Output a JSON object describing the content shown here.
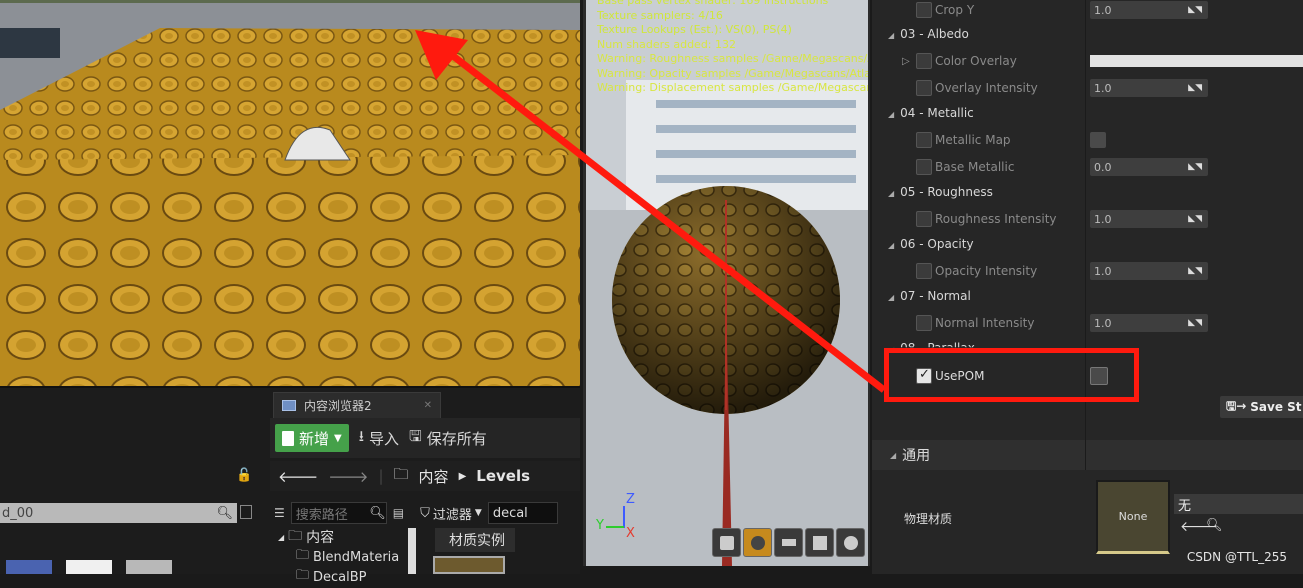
{
  "stats": {
    "lines": [
      "Base pass vertex shader: 169 instructions",
      "Texture samplers: 4/16",
      "Texture Lookups (Est.): VS(0), PS(4)",
      "Num shaders added: 132",
      "Warning: Roughness samples /Game/Megascans/Atl",
      "Warning: Opacity samples /Game/Megascans/Atlas",
      "Warning: Displacement samples /Game/Megascans"
    ]
  },
  "details": {
    "rows": [
      {
        "type": "param",
        "label": "Crop Y",
        "value": "1.0",
        "checked": false
      },
      {
        "type": "group",
        "label": "03 - Albedo"
      },
      {
        "type": "param",
        "label": "Color Overlay",
        "value": "",
        "checked": false,
        "expand": true
      },
      {
        "type": "param",
        "label": "Overlay Intensity",
        "value": "1.0",
        "checked": false
      },
      {
        "type": "group",
        "label": "04 - Metallic"
      },
      {
        "type": "param",
        "label": "Metallic Map",
        "value": "",
        "checked": false,
        "box": true
      },
      {
        "type": "param",
        "label": "Base Metallic",
        "value": "0.0",
        "checked": false
      },
      {
        "type": "group",
        "label": "05 - Roughness"
      },
      {
        "type": "param",
        "label": "Roughness Intensity",
        "value": "1.0",
        "checked": false
      },
      {
        "type": "group",
        "label": "06 - Opacity"
      },
      {
        "type": "param",
        "label": "Opacity Intensity",
        "value": "1.0",
        "checked": false
      },
      {
        "type": "group",
        "label": "07 - Normal"
      },
      {
        "type": "param",
        "label": "Normal Intensity",
        "value": "1.0",
        "checked": false
      },
      {
        "type": "group",
        "label": "08 - Parallax"
      },
      {
        "type": "param",
        "label": "UsePOM",
        "value": "",
        "checked": true,
        "box": true
      }
    ],
    "common_label": "通用",
    "phys_label": "物理材质",
    "phys_thumb": "None",
    "phys_value": "无",
    "save_label": "Save St"
  },
  "content_browser": {
    "tab_title": "内容浏览器2",
    "new_label": "新增",
    "import_label": "导入",
    "save_all_label": "保存所有",
    "path_root": "内容",
    "path_current": "Levels",
    "search_placeholder": "搜索路径",
    "filter_label": "过滤器",
    "filter_value": "decal",
    "tree_root": "内容",
    "tree_items": [
      "BlendMateria",
      "DecalBP"
    ],
    "asset_type": "材质实例",
    "left_search": "d_00"
  },
  "axes": {
    "z": "Z",
    "y": "Y",
    "x": "X"
  },
  "watermark": "CSDN @TTL_255",
  "colors": {
    "highlight": "#ff1a0e",
    "accent_new": "#45a14a",
    "tile": "#c8981f"
  }
}
